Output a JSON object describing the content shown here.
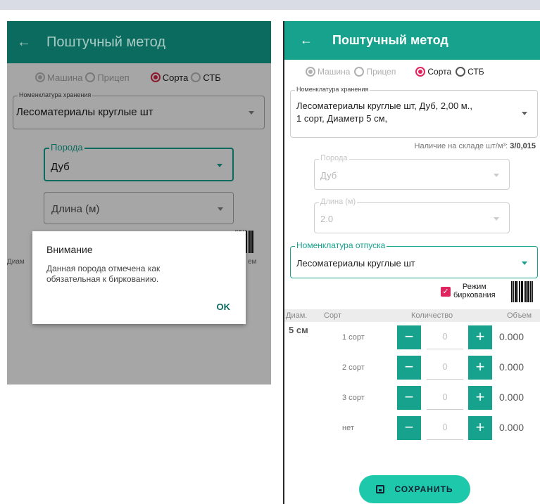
{
  "left_screen": {
    "app_bar": {
      "back_icon": "arrow-left",
      "title": "Поштучный метод"
    },
    "radio_group": [
      {
        "label": "Машина",
        "selected": true
      },
      {
        "label": "Прицеп",
        "selected": false
      },
      {
        "label": "Сорта",
        "selected": true
      },
      {
        "label": "СТБ",
        "selected": false
      }
    ],
    "storage_nomenclature": {
      "label": "Номенклатура хранения",
      "value": "Лесоматериалы круглые шт"
    },
    "species": {
      "label": "Порода",
      "value": "Дуб"
    },
    "length": {
      "placeholder": "Длина (м)"
    },
    "diam_partial": "Диам",
    "volume_partial": "ем",
    "dialog": {
      "title": "Внимание",
      "message": "Данная порода отмечена как обязательная к биркованию.",
      "ok_label": "OK"
    }
  },
  "right_screen": {
    "app_bar": {
      "back_icon": "arrow-left",
      "title": "Поштучный метод"
    },
    "radio_group": [
      {
        "label": "Машина",
        "selected": true
      },
      {
        "label": "Прицеп",
        "selected": false
      },
      {
        "label": "Сорта",
        "selected": true
      },
      {
        "label": "СТБ",
        "selected": false
      }
    ],
    "storage_nomenclature": {
      "label": "Номенклатура хранения",
      "line1": "Лесоматериалы круглые шт, Дуб, 2,00 м.,",
      "line2": "1 сорт, Диаметр 5 см,"
    },
    "stock": {
      "label": "Наличие на складе шт/м³:",
      "value": "3/0,015"
    },
    "species": {
      "label": "Порода",
      "value": "Дуб"
    },
    "length": {
      "label": "Длина (м)",
      "value": "2.0"
    },
    "release_nomenclature": {
      "label": "Номенклатура отпуска",
      "value": "Лесоматериалы круглые шт"
    },
    "tagging_mode": {
      "label_line1": "Режим",
      "label_line2": "биркования",
      "checked": true
    },
    "table": {
      "headers": {
        "diam": "Диам.",
        "sort": "Сорт",
        "qty": "Количество",
        "volume": "Объем"
      },
      "diameter": "5 см",
      "rows": [
        {
          "sort": "1 сорт",
          "qty": "0",
          "volume": "0.000"
        },
        {
          "sort": "2 сорт",
          "qty": "0",
          "volume": "0.000"
        },
        {
          "sort": "3 сорт",
          "qty": "0",
          "volume": "0.000"
        },
        {
          "sort": "нет",
          "qty": "0",
          "volume": "0.000"
        }
      ],
      "minus_label": "−",
      "plus_label": "+"
    },
    "save_button": {
      "label": "СОХРАНИТЬ",
      "icon": "floppy-disk-icon"
    }
  },
  "colors": {
    "left_appbar": "#0c6b5f",
    "left_overlay": "#a6a6a6",
    "right_appbar": "#16a28d",
    "stepper": "#16a28d",
    "save_button": "#1ec8ab",
    "accent_pink": "#e0245e"
  }
}
